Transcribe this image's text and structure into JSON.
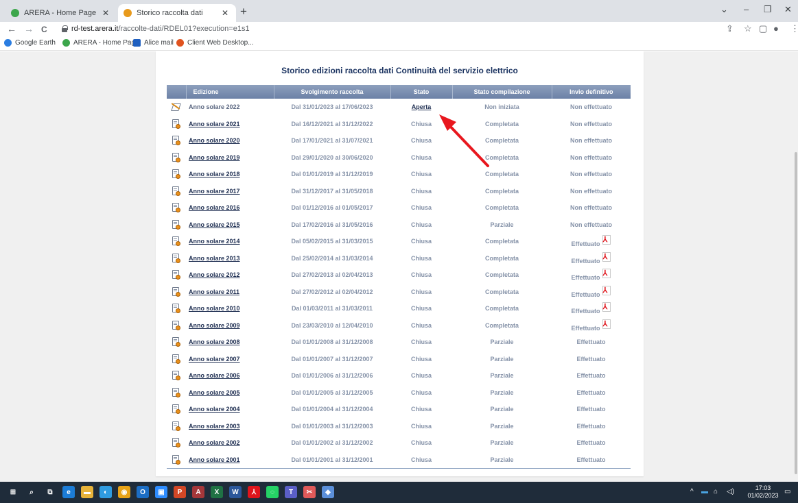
{
  "browser": {
    "tabs": [
      {
        "title": "ARERA - Home Page",
        "favicon": "arera-icon",
        "active": false
      },
      {
        "title": "Storico raccolta dati",
        "favicon": "gear-icon",
        "active": true
      }
    ],
    "new_tab": "+",
    "window_controls": {
      "chevron": "⌄",
      "minimize": "–",
      "restore": "❐",
      "close": "✕"
    },
    "nav": {
      "back": "←",
      "forward": "→",
      "reload": "C"
    },
    "url": {
      "host": "rd-test.arera.it",
      "path": "/raccolte-dati/RDEL01?execution=e1s1"
    },
    "toolbar_icons": {
      "share": "⇪",
      "bookmark": "☆",
      "sidebar": "▢",
      "profile": "●",
      "menu": "⋮"
    },
    "bookmarks": [
      {
        "label": "Google Earth",
        "icon": "google-earth-icon",
        "color": "#2a7de1"
      },
      {
        "label": "ARERA - Home Page",
        "icon": "arera-icon",
        "color": "#3ca64b"
      },
      {
        "label": "Alice mail",
        "icon": "mail-icon",
        "color": "#1f5fbf"
      },
      {
        "label": "Client Web Desktop...",
        "icon": "client-web-icon",
        "color": "#e0531f"
      }
    ]
  },
  "page": {
    "title": "Storico edizioni raccolta dati Continuità del servizio elettrico",
    "columns": [
      "Edizione",
      "Svolgimento raccolta",
      "Stato",
      "Stato compilazione",
      "Invio definitivo"
    ],
    "rows": [
      {
        "edizione": "Anno solare 2022",
        "svolgimento": "Dal 31/01/2023 al 17/06/2023",
        "stato": "Aperta",
        "compilazione": "Non iniziata",
        "invio": "Non effettuato",
        "pdf": false,
        "open": true
      },
      {
        "edizione": "Anno solare 2021",
        "svolgimento": "Dal 16/12/2021 al 31/12/2022",
        "stato": "Chiusa",
        "compilazione": "Completata",
        "invio": "Non effettuato",
        "pdf": false,
        "open": false
      },
      {
        "edizione": "Anno solare 2020",
        "svolgimento": "Dal 17/01/2021 al 31/07/2021",
        "stato": "Chiusa",
        "compilazione": "Completata",
        "invio": "Non effettuato",
        "pdf": false,
        "open": false
      },
      {
        "edizione": "Anno solare 2019",
        "svolgimento": "Dal 29/01/2020 al 30/06/2020",
        "stato": "Chiusa",
        "compilazione": "Completata",
        "invio": "Non effettuato",
        "pdf": false,
        "open": false
      },
      {
        "edizione": "Anno solare 2018",
        "svolgimento": "Dal 01/01/2019 al 31/12/2019",
        "stato": "Chiusa",
        "compilazione": "Completata",
        "invio": "Non effettuato",
        "pdf": false,
        "open": false
      },
      {
        "edizione": "Anno solare 2017",
        "svolgimento": "Dal 31/12/2017 al 31/05/2018",
        "stato": "Chiusa",
        "compilazione": "Completata",
        "invio": "Non effettuato",
        "pdf": false,
        "open": false
      },
      {
        "edizione": "Anno solare 2016",
        "svolgimento": "Dal 01/12/2016 al 01/05/2017",
        "stato": "Chiusa",
        "compilazione": "Completata",
        "invio": "Non effettuato",
        "pdf": false,
        "open": false
      },
      {
        "edizione": "Anno solare 2015",
        "svolgimento": "Dal 17/02/2016 al 31/05/2016",
        "stato": "Chiusa",
        "compilazione": "Parziale",
        "invio": "Non effettuato",
        "pdf": false,
        "open": false
      },
      {
        "edizione": "Anno solare 2014",
        "svolgimento": "Dal 05/02/2015 al 31/03/2015",
        "stato": "Chiusa",
        "compilazione": "Completata",
        "invio": "Effettuato",
        "pdf": true,
        "open": false
      },
      {
        "edizione": "Anno solare 2013",
        "svolgimento": "Dal 25/02/2014 al 31/03/2014",
        "stato": "Chiusa",
        "compilazione": "Completata",
        "invio": "Effettuato",
        "pdf": true,
        "open": false
      },
      {
        "edizione": "Anno solare 2012",
        "svolgimento": "Dal 27/02/2013 al 02/04/2013",
        "stato": "Chiusa",
        "compilazione": "Completata",
        "invio": "Effettuato",
        "pdf": true,
        "open": false
      },
      {
        "edizione": "Anno solare 2011",
        "svolgimento": "Dal 27/02/2012 al 02/04/2012",
        "stato": "Chiusa",
        "compilazione": "Completata",
        "invio": "Effettuato",
        "pdf": true,
        "open": false
      },
      {
        "edizione": "Anno solare 2010",
        "svolgimento": "Dal 01/03/2011 al 31/03/2011",
        "stato": "Chiusa",
        "compilazione": "Completata",
        "invio": "Effettuato",
        "pdf": true,
        "open": false
      },
      {
        "edizione": "Anno solare 2009",
        "svolgimento": "Dal 23/03/2010 al 12/04/2010",
        "stato": "Chiusa",
        "compilazione": "Completata",
        "invio": "Effettuato",
        "pdf": true,
        "open": false
      },
      {
        "edizione": "Anno solare 2008",
        "svolgimento": "Dal 01/01/2008 al 31/12/2008",
        "stato": "Chiusa",
        "compilazione": "Parziale",
        "invio": "Effettuato",
        "pdf": false,
        "open": false
      },
      {
        "edizione": "Anno solare 2007",
        "svolgimento": "Dal 01/01/2007 al 31/12/2007",
        "stato": "Chiusa",
        "compilazione": "Parziale",
        "invio": "Effettuato",
        "pdf": false,
        "open": false
      },
      {
        "edizione": "Anno solare 2006",
        "svolgimento": "Dal 01/01/2006 al 31/12/2006",
        "stato": "Chiusa",
        "compilazione": "Parziale",
        "invio": "Effettuato",
        "pdf": false,
        "open": false
      },
      {
        "edizione": "Anno solare 2005",
        "svolgimento": "Dal 01/01/2005 al 31/12/2005",
        "stato": "Chiusa",
        "compilazione": "Parziale",
        "invio": "Effettuato",
        "pdf": false,
        "open": false
      },
      {
        "edizione": "Anno solare 2004",
        "svolgimento": "Dal 01/01/2004 al 31/12/2004",
        "stato": "Chiusa",
        "compilazione": "Parziale",
        "invio": "Effettuato",
        "pdf": false,
        "open": false
      },
      {
        "edizione": "Anno solare 2003",
        "svolgimento": "Dal 01/01/2003 al 31/12/2003",
        "stato": "Chiusa",
        "compilazione": "Parziale",
        "invio": "Effettuato",
        "pdf": false,
        "open": false
      },
      {
        "edizione": "Anno solare 2002",
        "svolgimento": "Dal 01/01/2002 al 31/12/2002",
        "stato": "Chiusa",
        "compilazione": "Parziale",
        "invio": "Effettuato",
        "pdf": false,
        "open": false
      },
      {
        "edizione": "Anno solare 2001",
        "svolgimento": "Dal 01/01/2001 al 31/12/2001",
        "stato": "Chiusa",
        "compilazione": "Parziale",
        "invio": "Effettuato",
        "pdf": false,
        "open": false
      }
    ],
    "annotation_color": "#e8171e"
  },
  "taskbar": {
    "apps": [
      {
        "name": "windows-start-icon",
        "glyph": "⊞",
        "color": "#1f2c3a"
      },
      {
        "name": "search-icon",
        "glyph": "⌕",
        "color": "#1f2c3a"
      },
      {
        "name": "task-view-icon",
        "glyph": "⧉",
        "color": "#1f2c3a"
      },
      {
        "name": "edge-legacy-icon",
        "glyph": "e",
        "color": "#1c7cd6"
      },
      {
        "name": "file-explorer-icon",
        "glyph": "▬",
        "color": "#e7b33a"
      },
      {
        "name": "edge-icon",
        "glyph": "◐",
        "color": "#2f9be0"
      },
      {
        "name": "chrome-icon",
        "glyph": "◉",
        "color": "#e8a317"
      },
      {
        "name": "outlook-icon",
        "glyph": "O",
        "color": "#1c6ec5"
      },
      {
        "name": "zoom-icon",
        "glyph": "▣",
        "color": "#2d8cff"
      },
      {
        "name": "powerpoint-icon",
        "glyph": "P",
        "color": "#d24726"
      },
      {
        "name": "access-icon",
        "glyph": "A",
        "color": "#a4373a"
      },
      {
        "name": "excel-icon",
        "glyph": "X",
        "color": "#1f7244"
      },
      {
        "name": "word-icon",
        "glyph": "W",
        "color": "#2b579a"
      },
      {
        "name": "acrobat-icon",
        "glyph": "⅄",
        "color": "#e0141b"
      },
      {
        "name": "whatsapp-icon",
        "glyph": "◌",
        "color": "#25d366"
      },
      {
        "name": "teams-icon",
        "glyph": "T",
        "color": "#5b5fc7"
      },
      {
        "name": "snipping-tool-icon",
        "glyph": "✂",
        "color": "#e05a5a"
      },
      {
        "name": "paint-3d-icon",
        "glyph": "◆",
        "color": "#5b8fd9"
      }
    ],
    "tray": {
      "chevron": "^",
      "battery": "▬",
      "network": "⌂",
      "volume": "◁)"
    },
    "time": "17:03",
    "date": "01/02/2023",
    "notification": "▭"
  }
}
